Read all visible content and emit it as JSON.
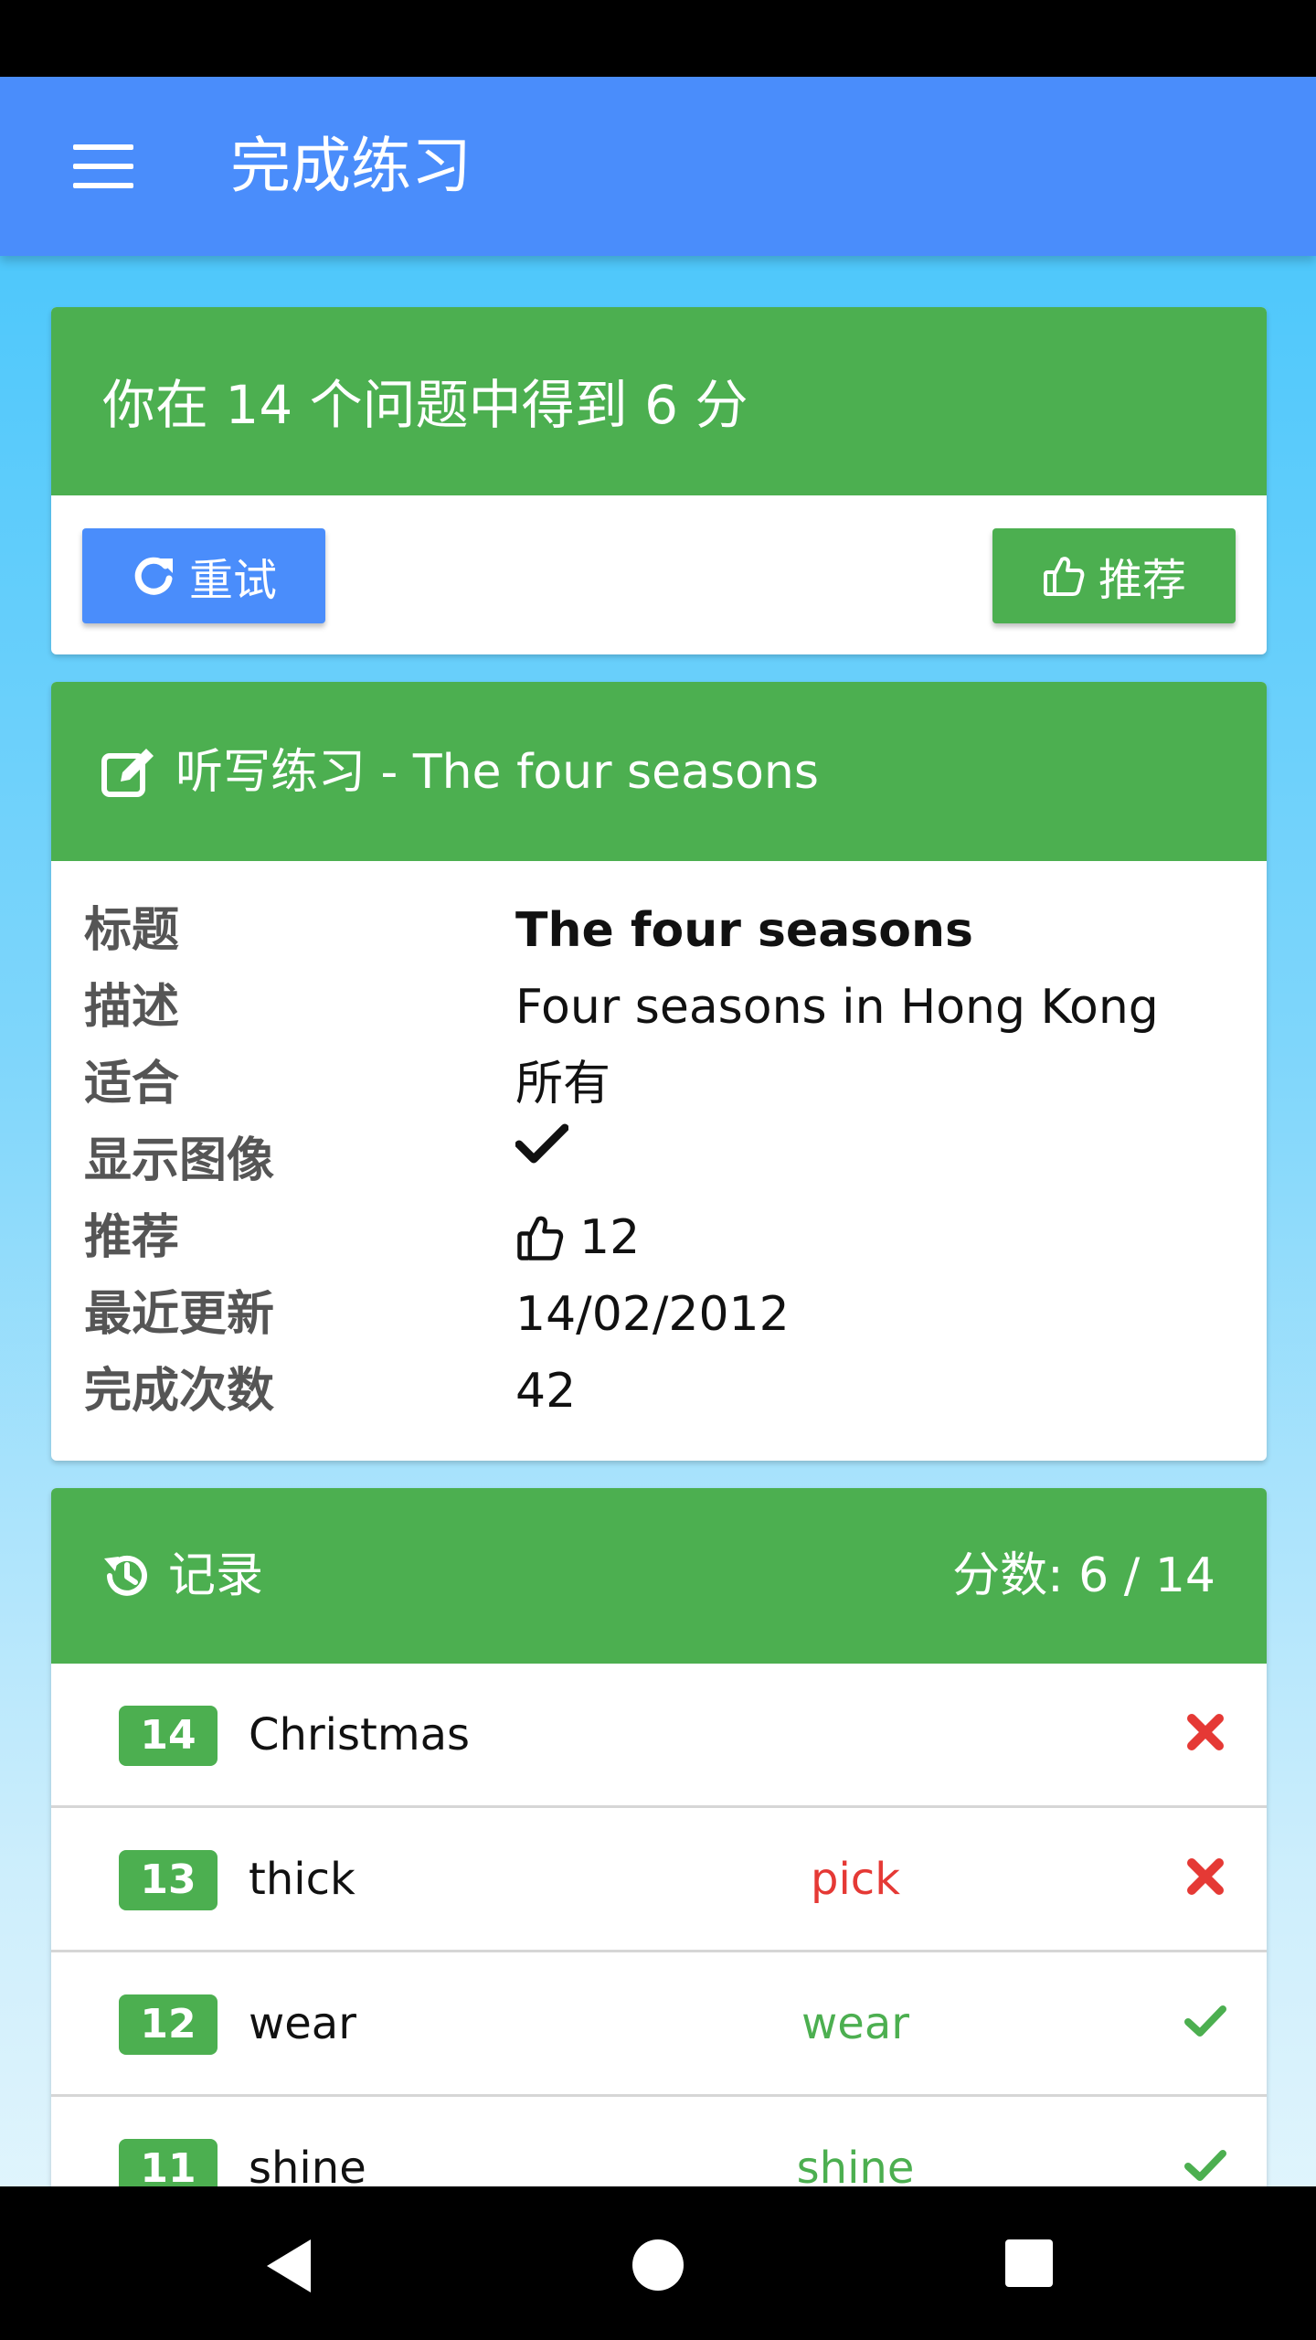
{
  "app_bar": {
    "title": "完成练习",
    "menu_icon": "hamburger-menu-icon"
  },
  "score_card": {
    "text": "你在 14 个问题中得到 6 分",
    "retry_label": "重试",
    "retry_icon": "redo-icon",
    "recommend_label": "推荐",
    "recommend_icon": "thumbs-up-icon",
    "header_color": "#4caf50",
    "retry_color": "#4a8dfb"
  },
  "info_card": {
    "title": "听写练习 - The four seasons",
    "title_icon": "edit-icon",
    "rows": [
      {
        "label": "标题",
        "value": "The four seasons"
      },
      {
        "label": "描述",
        "value": "Four seasons in Hong Kong"
      },
      {
        "label": "适合",
        "value": "所有"
      },
      {
        "label": "显示图像",
        "value": "",
        "icon": "check-icon"
      },
      {
        "label": "推荐",
        "value": "12",
        "icon": "thumbs-up-icon"
      },
      {
        "label": "最近更新",
        "value": "14/02/2012"
      },
      {
        "label": "完成次数",
        "value": "42"
      }
    ]
  },
  "history_card": {
    "title": "记录",
    "title_icon": "history-icon",
    "score": "分数: 6 / 14",
    "items": [
      {
        "num": "14",
        "word": "Christmas",
        "answer": "",
        "status": "wrong"
      },
      {
        "num": "13",
        "word": "thick",
        "answer": "pick",
        "status": "wrong"
      },
      {
        "num": "12",
        "word": "wear",
        "answer": "wear",
        "status": "correct"
      },
      {
        "num": "11",
        "word": "shine",
        "answer": "shine",
        "status": "correct"
      }
    ],
    "wrong_color": "#e53935",
    "correct_color": "#4caf50"
  },
  "nav_bar": {
    "back_icon": "back-triangle-icon",
    "home_icon": "home-circle-icon",
    "recents_icon": "recents-square-icon"
  }
}
